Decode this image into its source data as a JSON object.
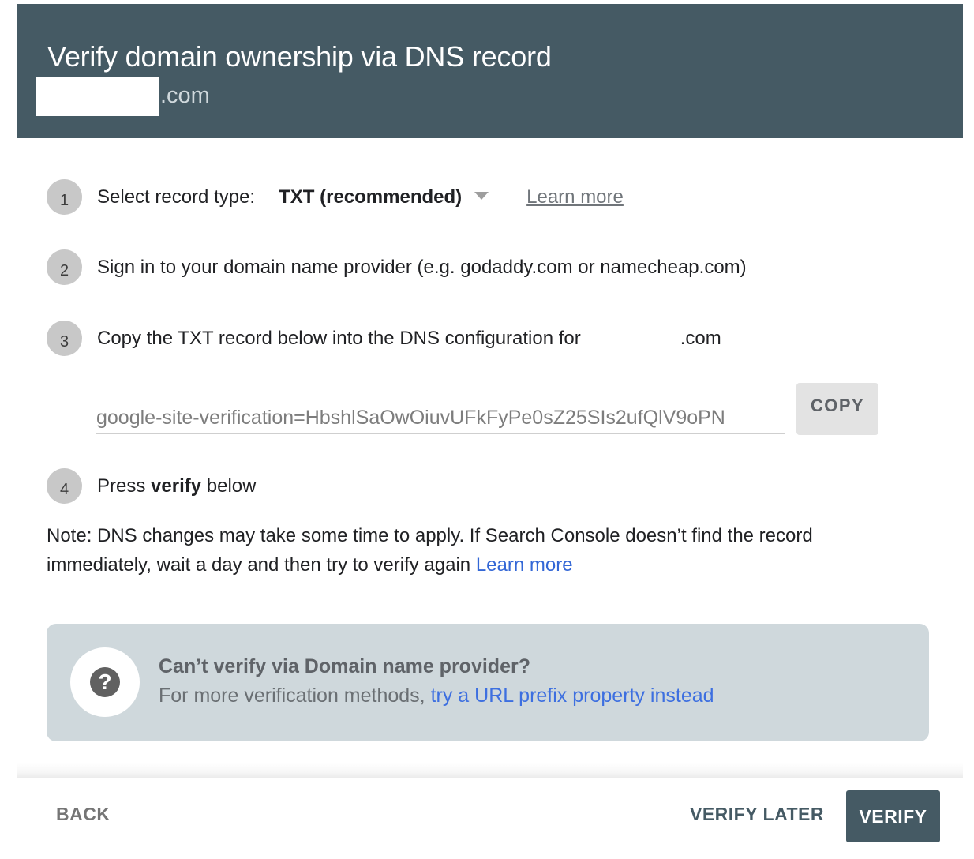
{
  "header": {
    "title": "Verify domain ownership via DNS record",
    "domain_suffix": ".com"
  },
  "steps": [
    {
      "number": "1",
      "label": "Select record type:",
      "record_type": "TXT (recommended)",
      "learn_more": "Learn more"
    },
    {
      "number": "2",
      "label": "Sign in to your domain name provider (e.g. godaddy.com or namecheap.com)"
    },
    {
      "number": "3",
      "label": "Copy the TXT record below into the DNS configuration for",
      "domain_suffix": ".com",
      "txt_record": "google-site-verification=HbshlSaOwOiuvUFkFyPe0sZ25SIs2ufQlV9oPN",
      "copy_label": "COPY"
    },
    {
      "number": "4",
      "label_prefix": "Press",
      "label_bold": "verify",
      "label_suffix": "below"
    }
  ],
  "note": {
    "text": "Note: DNS changes may take some time to apply. If Search Console doesn’t find the record immediately, wait a day and then try to verify again",
    "link": "Learn more"
  },
  "alternative": {
    "icon": "help-question-icon",
    "title": "Can’t verify via Domain name provider?",
    "text": "For more verification methods,",
    "link": "try a URL prefix property instead"
  },
  "footer": {
    "back_label": "BACK",
    "verify_later_label": "VERIFY LATER",
    "verify_label": "VERIFY"
  },
  "colors": {
    "header_bg": "#455a64",
    "link": "#3367d6",
    "alt_box_bg": "#cfd8dc",
    "primary_button": "#455a64"
  }
}
